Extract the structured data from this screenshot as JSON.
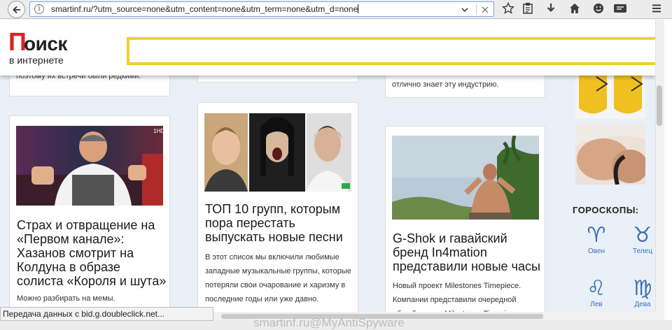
{
  "browser": {
    "url": "smartinf.ru/?utm_source=none&utm_content=none&utm_term=none&utm_d=none",
    "status_text": "Передача данных с bid.g.doubleclick.net..."
  },
  "site": {
    "logo_first_letter": "П",
    "logo_rest": "оиск",
    "logo_subtitle": "в интернете"
  },
  "articles": {
    "col1_top_text": "поэтому их встречи были редкими.",
    "col1_title": "Страх и отвращение на «Первом канале»: Хазанов смотрит на Колдуна в образе солиста «Короля и шута»",
    "col1_text": "Можно разбирать на мемы.",
    "col2_title": "ТОП 10 групп, которым пора перестать выпускать новые песни",
    "col2_text": "В этот список мы включили любимые западные музыкальные группы, которые потеряли свои очарование и харизму в последние годы или уже давно.",
    "col3_top_text": "отлично знает эту индустрию.",
    "col3_title": "G-Shok и гавайский бренд In4mation представили новые часы",
    "col3_text": "Новый проект Milestones Timepiece. Компании представили очередной общий проект Milestones Timepiece"
  },
  "sidebar": {
    "horoscope_heading": "ГОРОСКОПЫ:",
    "signs": [
      {
        "symbol": "♈",
        "label": "Овен"
      },
      {
        "symbol": "♉",
        "label": "Телец"
      },
      {
        "symbol": "♌",
        "label": "Лев"
      },
      {
        "symbol": "♍",
        "label": "Дева"
      }
    ]
  },
  "watermark": "smartinf.ru@MyAntiSpyware",
  "icons": {
    "back": "back-arrow-icon",
    "info": "info-icon",
    "dropdown": "chevron-down-icon",
    "clear": "close-icon",
    "bookmark": "star-icon",
    "reader": "clipboard-icon",
    "download": "download-arrow-icon",
    "home": "home-icon",
    "smiley": "smiley-icon",
    "menu": "hamburger-menu-icon"
  }
}
